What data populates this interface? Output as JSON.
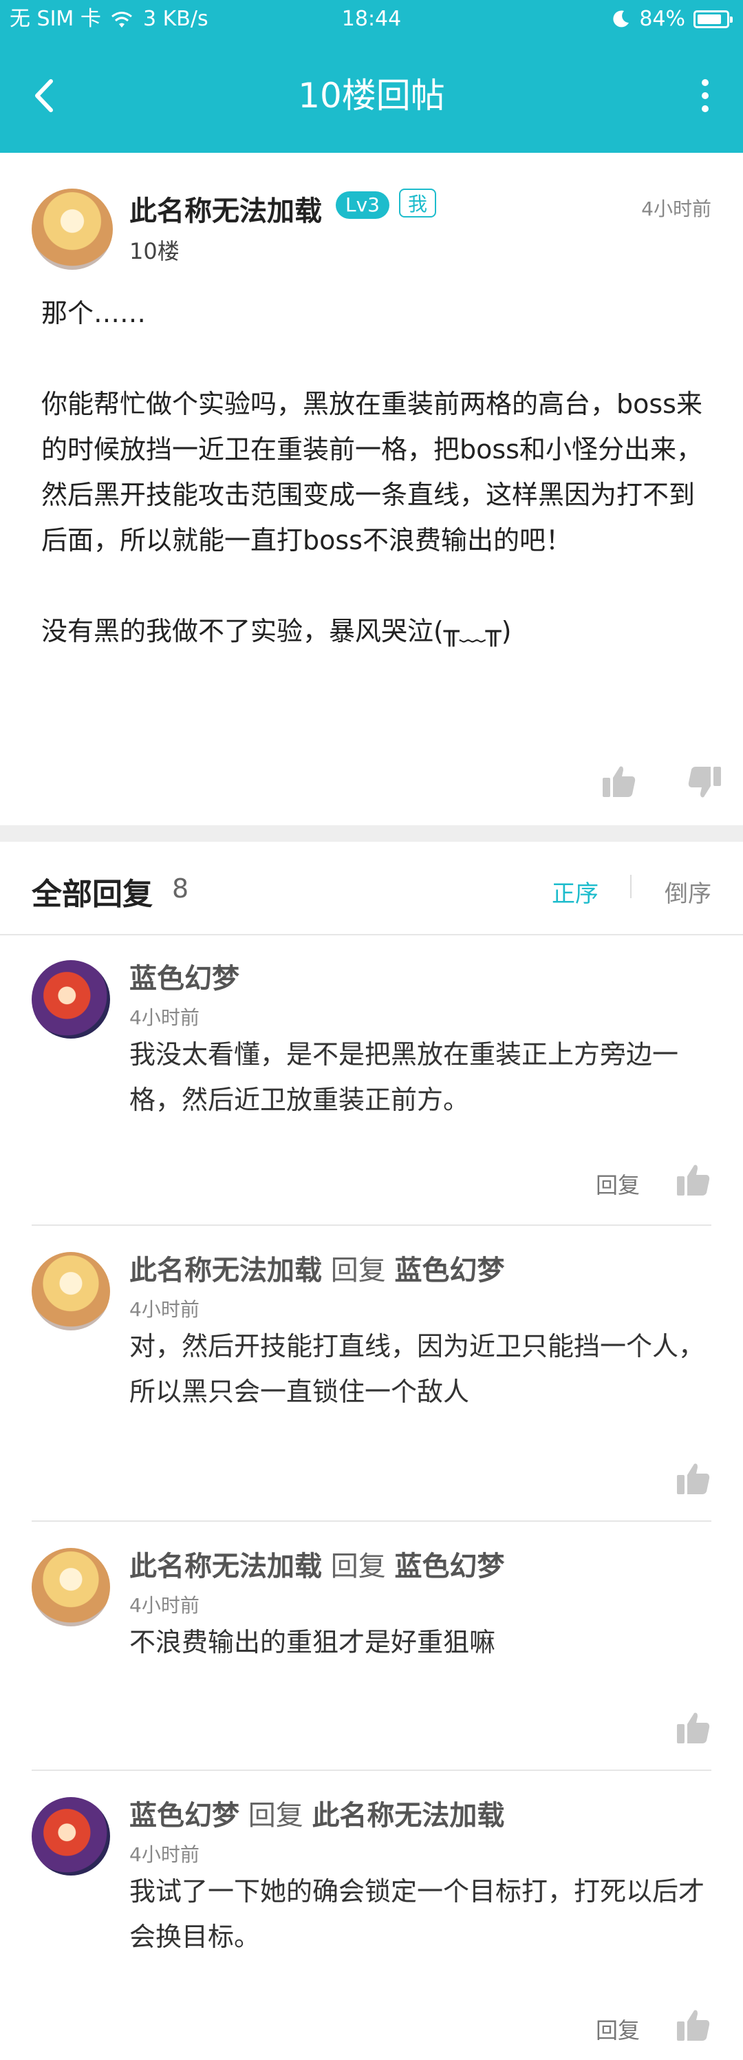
{
  "status_bar": {
    "carrier": "无 SIM 卡",
    "net_speed": "3 KB/s",
    "time": "18:44",
    "battery": "84%",
    "battery_level": 0.84
  },
  "navbar": {
    "title": "10楼回帖",
    "back_icon": "chevron-left-icon",
    "more_icon": "more-vertical-icon",
    "color": "#1dbccc"
  },
  "post": {
    "author": "此名称无法加载",
    "level_badge": "Lv3",
    "me_badge": "我",
    "time": "4小时前",
    "floor": "10楼",
    "paragraphs": [
      "那个……",
      "",
      "你能帮忙做个实验吗，黑放在重装前两格的高台，boss来的时候放挡一近卫在重装前一格，把boss和小怪分出来，然后黑开技能攻击范围变成一条直线，这样黑因为打不到后面，所以就能一直打boss不浪费输出的吧！",
      "",
      "没有黑的我做不了实验，暴风哭泣(╥﹏╥)"
    ]
  },
  "replies_header": {
    "title": "全部回复",
    "count": "8",
    "sort_asc": "正序",
    "sort_desc": "倒序"
  },
  "replies": [
    {
      "author": "蓝色幻梦",
      "reply_word": "",
      "reply_to": "",
      "time": "4小时前",
      "text": "我没太看懂，是不是把黑放在重装正上方旁边一格，然后近卫放重装正前方。",
      "reply_label": "回复",
      "avatar": "red-hair-avatar"
    },
    {
      "author": "此名称无法加载",
      "reply_word": "回复",
      "reply_to": "蓝色幻梦",
      "time": "4小时前",
      "text": "对，然后开技能打直线，因为近卫只能挡一个人，所以黑只会一直锁住一个敌人",
      "reply_label": "",
      "avatar": "blonde-avatar"
    },
    {
      "author": "此名称无法加载",
      "reply_word": "回复",
      "reply_to": "蓝色幻梦",
      "time": "4小时前",
      "text": "不浪费输出的重狙才是好重狙嘛",
      "reply_label": "",
      "avatar": "blonde-avatar"
    },
    {
      "author": "蓝色幻梦",
      "reply_word": "回复",
      "reply_to": "此名称无法加载",
      "time": "4小时前",
      "text": "我试了一下她的确会锁定一个目标打，打死以后才会换目标。",
      "reply_label": "回复",
      "avatar": "red-hair-avatar"
    }
  ]
}
